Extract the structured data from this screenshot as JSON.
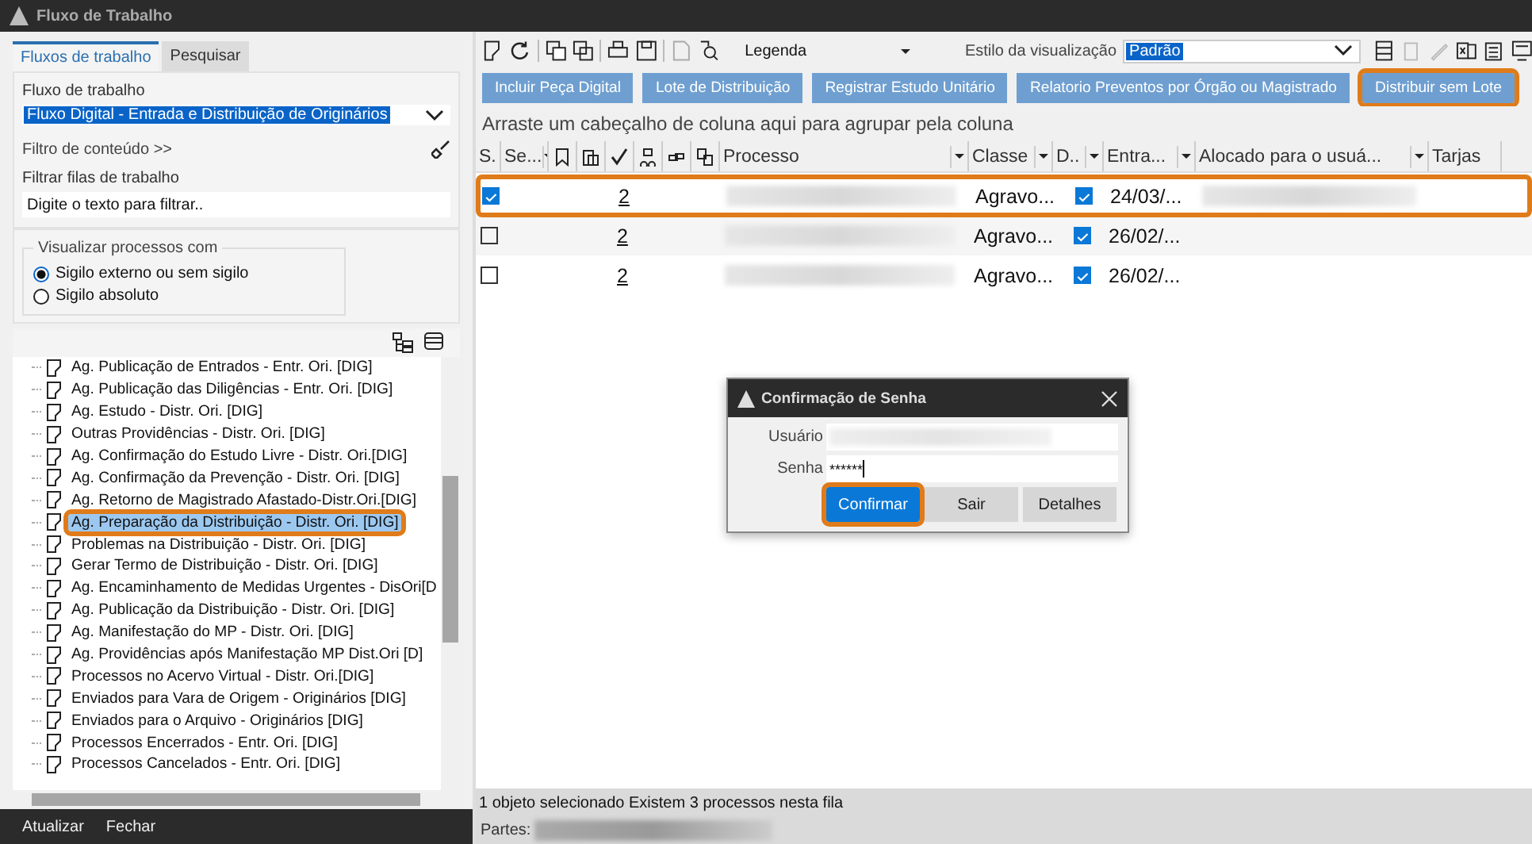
{
  "window": {
    "title": "Fluxo de Trabalho"
  },
  "left_panel": {
    "tabs": [
      {
        "label": "Fluxos de trabalho",
        "selected": true
      },
      {
        "label": "Pesquisar",
        "selected": false
      }
    ],
    "workflow": {
      "label": "Fluxo de trabalho",
      "value": "Fluxo Digital - Entrada e Distribuição de Originários"
    },
    "content_filter": "Filtro de conteúdo >>",
    "queue_filter": {
      "label": "Filtrar filas de trabalho",
      "placeholder": "Digite o texto para filtrar.."
    },
    "visibility": {
      "legend": "Visualizar processos com",
      "options": [
        {
          "label": "Sigilo externo ou sem sigilo",
          "selected": true
        },
        {
          "label": "Sigilo absoluto",
          "selected": false
        }
      ]
    },
    "tree": {
      "items": [
        {
          "label": "Ag. Publicação de Entrados - Entr. Ori. [DIG]",
          "selected": false,
          "highlighted": false
        },
        {
          "label": "Ag. Publicação das Diligências - Entr. Ori. [DIG]",
          "selected": false,
          "highlighted": false
        },
        {
          "label": "Ag. Estudo - Distr. Ori. [DIG]",
          "selected": false,
          "highlighted": false
        },
        {
          "label": "Outras Providências - Distr. Ori. [DIG]",
          "selected": false,
          "highlighted": false
        },
        {
          "label": "Ag. Confirmação do Estudo Livre - Distr. Ori.[DIG]",
          "selected": false,
          "highlighted": false
        },
        {
          "label": "Ag. Confirmação da Prevenção - Distr. Ori. [DIG]",
          "selected": false,
          "highlighted": false
        },
        {
          "label": "Ag. Retorno de Magistrado Afastado-Distr.Ori.[DIG]",
          "selected": false,
          "highlighted": false
        },
        {
          "label": "Ag. Preparação da Distribuição - Distr. Ori. [DIG]",
          "selected": true,
          "highlighted": true
        },
        {
          "label": "Problemas na Distribuição - Distr. Ori. [DIG]",
          "selected": false,
          "highlighted": false
        },
        {
          "label": "Gerar Termo de Distribuição - Distr. Ori. [DIG]",
          "selected": false,
          "highlighted": false
        },
        {
          "label": "Ag. Encaminhamento de Medidas Urgentes - DisOri[D",
          "selected": false,
          "highlighted": false
        },
        {
          "label": "Ag. Publicação da Distribuição - Distr. Ori. [DIG]",
          "selected": false,
          "highlighted": false
        },
        {
          "label": "Ag. Manifestação do MP - Distr. Ori. [DIG]",
          "selected": false,
          "highlighted": false
        },
        {
          "label": "Ag. Providências após Manifestação MP Dist.Ori [D]",
          "selected": false,
          "highlighted": false
        },
        {
          "label": "Processos no Acervo Virtual - Distr. Ori.[DIG]",
          "selected": false,
          "highlighted": false
        },
        {
          "label": "Enviados para Vara de Origem - Originários [DIG]",
          "selected": false,
          "highlighted": false
        },
        {
          "label": "Enviados para o Arquivo - Originários [DIG]",
          "selected": false,
          "highlighted": false
        },
        {
          "label": "Processos Encerrados - Entr. Ori. [DIG]",
          "selected": false,
          "highlighted": false
        },
        {
          "label": "Processos Cancelados - Entr. Ori. [DIG]",
          "selected": false,
          "highlighted": false
        }
      ]
    },
    "buttons": [
      "Atualizar",
      "Fechar"
    ]
  },
  "toolbar": {
    "legend_label": "Legenda",
    "view_style_label": "Estilo da visualização",
    "view_style_value": "Padrão"
  },
  "action_buttons": [
    {
      "label": "Incluir Peça Digital",
      "highlighted": false
    },
    {
      "label": "Lote de Distribuição",
      "highlighted": false
    },
    {
      "label": "Registrar Estudo Unitário",
      "highlighted": false
    },
    {
      "label": "Relatorio Preventos por Órgão ou Magistrado",
      "highlighted": false
    },
    {
      "label": "Distribuir sem Lote",
      "highlighted": true
    }
  ],
  "group_hint": "Arraste um cabeçalho de coluna aqui para agrupar pela coluna",
  "table": {
    "columns": [
      {
        "label": "S.",
        "filter": false
      },
      {
        "label": "Se...",
        "filter": true
      },
      {
        "label": "Processo",
        "filter": true
      },
      {
        "label": "Classe",
        "filter": true
      },
      {
        "label": "D..",
        "filter": true
      },
      {
        "label": "Entra...",
        "filter": true
      },
      {
        "label": "Alocado para o usuá...",
        "filter": true
      },
      {
        "label": "Tarjas",
        "filter": false
      }
    ],
    "rows": [
      {
        "selected": true,
        "highlighted": true,
        "count": "2",
        "classe": "Agravo...",
        "d_checked": true,
        "entrada": "24/03/...",
        "allocated_redacted": true
      },
      {
        "selected": false,
        "highlighted": false,
        "count": "2",
        "classe": "Agravo...",
        "d_checked": true,
        "entrada": "26/02/...",
        "allocated_redacted": false
      },
      {
        "selected": false,
        "highlighted": false,
        "count": "2",
        "classe": "Agravo...",
        "d_checked": true,
        "entrada": "26/02/...",
        "allocated_redacted": false
      }
    ]
  },
  "status_bar": {
    "summary": "1 objeto selecionado  Existem 3 processos nesta fila",
    "parts_label": "Partes:"
  },
  "dialog": {
    "title": "Confirmação de Senha",
    "fields": [
      {
        "label": "Usuário",
        "redacted": true
      },
      {
        "label": "Senha",
        "value": "******",
        "redacted": false
      }
    ],
    "buttons": [
      {
        "label": "Confirmar",
        "primary": true,
        "highlighted": true
      },
      {
        "label": "Sair",
        "primary": false,
        "highlighted": false
      },
      {
        "label": "Detalhes",
        "primary": false,
        "highlighted": false
      }
    ]
  }
}
